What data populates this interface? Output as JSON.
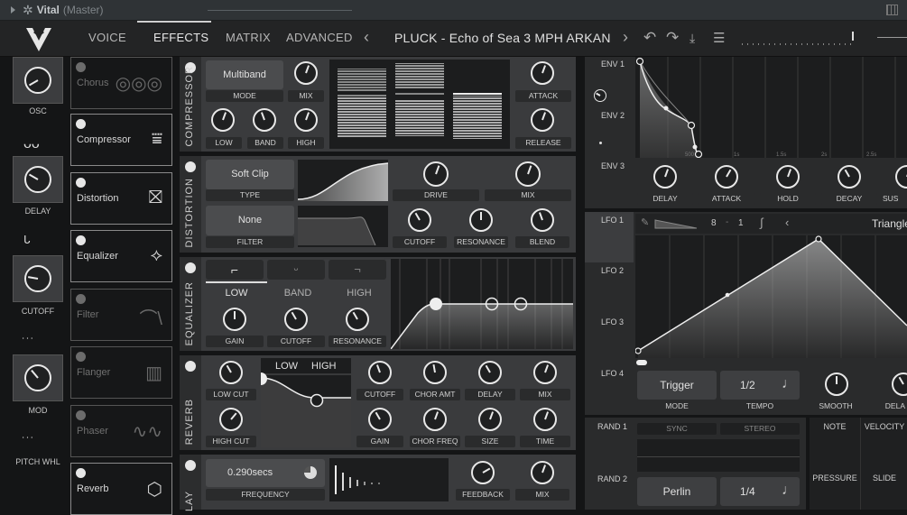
{
  "titlebar": {
    "app": "Vital",
    "mode": "(Master)"
  },
  "tabs": [
    "VOICE",
    "EFFECTS",
    "MATRIX",
    "ADVANCED"
  ],
  "preset": "PLUCK - Echo of Sea 3 MPH ARKAN",
  "mod_sources": {
    "osc": "OSC",
    "delay": "DELAY",
    "cutoff": "CUTOFF",
    "mod": "MOD",
    "pitch": "PITCH WHL"
  },
  "effects": [
    {
      "name": "Chorus",
      "on": false,
      "icon": "chorus-icon"
    },
    {
      "name": "Compressor",
      "on": true,
      "icon": "compressor-icon"
    },
    {
      "name": "Distortion",
      "on": true,
      "icon": "distortion-icon"
    },
    {
      "name": "Equalizer",
      "on": true,
      "icon": "equalizer-icon"
    },
    {
      "name": "Filter",
      "on": false,
      "icon": "filter-icon"
    },
    {
      "name": "Flanger",
      "on": false,
      "icon": "flanger-icon"
    },
    {
      "name": "Phaser",
      "on": false,
      "icon": "phaser-icon"
    },
    {
      "name": "Reverb",
      "on": true,
      "icon": "reverb-icon"
    }
  ],
  "compressor": {
    "title": "COMPRESSOR",
    "mode_value": "Multiband",
    "mode": "MODE",
    "mix": "MIX",
    "low": "LOW",
    "band": "BAND",
    "high": "HIGH",
    "attack": "ATTACK",
    "release": "RELEASE"
  },
  "distortion": {
    "title": "DISTORTION",
    "type_value": "Soft Clip",
    "type": "TYPE",
    "filter_value": "None",
    "filter": "FILTER",
    "drive": "DRIVE",
    "mix": "MIX",
    "cutoff": "CUTOFF",
    "resonance": "RESONANCE",
    "blend": "BLEND"
  },
  "equalizer": {
    "title": "EQUALIZER",
    "low": "LOW",
    "band": "BAND",
    "high": "HIGH",
    "gain": "GAIN",
    "cutoff": "CUTOFF",
    "resonance": "RESONANCE"
  },
  "reverb": {
    "title": "REVERB",
    "low": "LOW",
    "high": "HIGH",
    "low_cut": "LOW CUT",
    "high_cut": "HIGH CUT",
    "cutoff": "CUTOFF",
    "chor_amt": "CHOR AMT",
    "delay": "DELAY",
    "mix": "MIX",
    "gain": "GAIN",
    "chor_freq": "CHOR FREQ",
    "size": "SIZE",
    "time": "TIME"
  },
  "delay": {
    "title": "LAY",
    "frequency_value": "0.290secs",
    "frequency": "FREQUENCY",
    "feedback": "FEEDBACK",
    "mix": "MIX"
  },
  "env": {
    "tabs": [
      "ENV 1",
      "ENV 2",
      "ENV 3"
    ],
    "delay": "DELAY",
    "attack": "ATTACK",
    "hold": "HOLD",
    "decay": "DECAY",
    "sustain": "SUS",
    "time_marks": [
      "500",
      "1s",
      "1.5s",
      "2s",
      "2.5s"
    ]
  },
  "lfo": {
    "tabs": [
      "LFO 1",
      "LFO 2",
      "LFO 3",
      "LFO 4"
    ],
    "grid_x": "8",
    "grid_y": "1",
    "shape": "Triangle",
    "mode_value": "Trigger",
    "mode": "MODE",
    "tempo_value": "1/2",
    "tempo": "TEMPO",
    "smooth": "SMOOTH",
    "delay": "DELA"
  },
  "rand": {
    "tabs": [
      "RAND 1",
      "RAND 2"
    ],
    "sync": "SYNC",
    "stereo": "STEREO",
    "type_value": "Perlin",
    "tempo_value": "1/4"
  },
  "misc": {
    "note": "NOTE",
    "velocity": "VELOCITY",
    "pressure": "PRESSURE",
    "slide": "SLIDE"
  }
}
